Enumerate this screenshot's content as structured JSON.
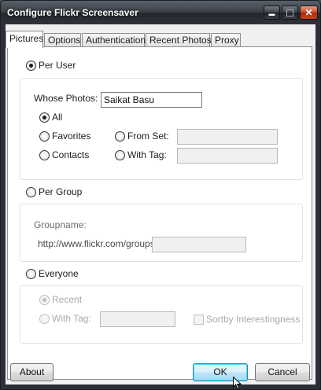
{
  "window": {
    "title": "Configure Flickr Screensaver"
  },
  "titlebar_buttons": {
    "minimize": "▬",
    "maximize": "□",
    "close": "✕"
  },
  "tabs": [
    {
      "label": "Pictures",
      "active": true
    },
    {
      "label": "Options"
    },
    {
      "label": "Authentication"
    },
    {
      "label": "Recent Photos"
    },
    {
      "label": "Proxy"
    }
  ],
  "per_user": {
    "label": "Per User",
    "selected": true,
    "whose_photos_label": "Whose Photos:",
    "whose_photos_value": "Saikat Basu",
    "all_label": "All",
    "favorites_label": "Favorites",
    "contacts_label": "Contacts",
    "from_set_label": "From Set:",
    "with_tag_label": "With Tag:"
  },
  "per_group": {
    "label": "Per Group",
    "groupname_label": "Groupname:",
    "url_prefix": "http://www.flickr.com/groups/"
  },
  "everyone": {
    "label": "Everyone",
    "recent_label": "Recent",
    "with_tag_label": "With Tag:",
    "sort_label": "Sortby Interestingness"
  },
  "buttons": {
    "about": "About",
    "ok": "OK",
    "cancel": "Cancel"
  }
}
